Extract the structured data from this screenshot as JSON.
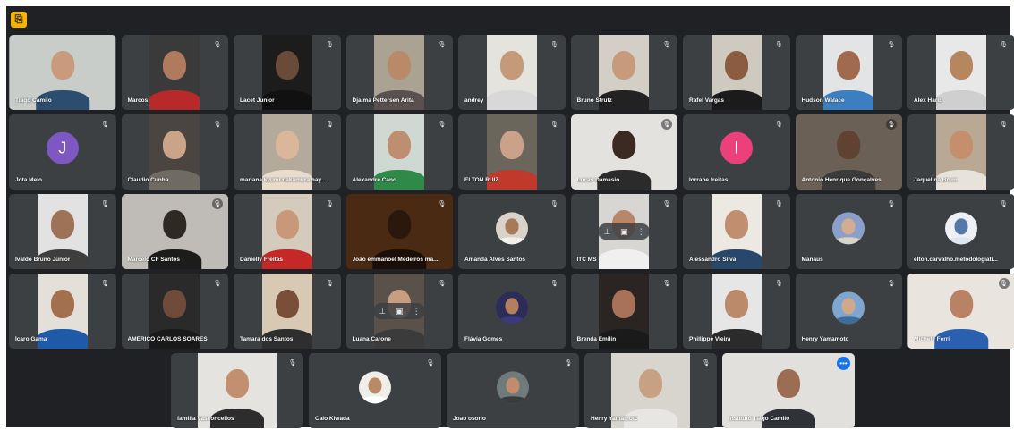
{
  "toolbar": {
    "icon": "meeting-details-icon",
    "icon_glyph": "⎘"
  },
  "accent_color": "#8ab4f8",
  "tile_background": "#3c4043",
  "participants": [
    {
      "name": "Tiago Camilo",
      "muted": false,
      "view": "full",
      "bg": "#c8cdc9",
      "skin": "#c99a7c",
      "shirt": "#2d4d6e"
    },
    {
      "name": "Marcos",
      "muted": true,
      "view": "narrow",
      "bg": "#3a3a3a",
      "skin": "#b07a5e",
      "shirt": "#b82a2a"
    },
    {
      "name": "Lacet Junior",
      "muted": true,
      "view": "narrow",
      "bg": "#1c1c1c",
      "skin": "#6a4a38",
      "shirt": "#111111"
    },
    {
      "name": "Djalma Pettersen Arita",
      "muted": true,
      "view": "narrow",
      "bg": "#aaa293",
      "skin": "#b98a6a",
      "shirt": "#5a5050"
    },
    {
      "name": "andrey",
      "muted": true,
      "view": "narrow",
      "bg": "#e5e3dd",
      "skin": "#c49a7a",
      "shirt": "#d8d8d8"
    },
    {
      "name": "Bruno Strutz",
      "muted": true,
      "view": "narrow",
      "bg": "#d3cfc6",
      "skin": "#c79a7c",
      "shirt": "#222222"
    },
    {
      "name": "Rafel Vargas",
      "muted": true,
      "view": "narrow",
      "bg": "#cfcac0",
      "skin": "#8c5c42",
      "shirt": "#1b1b1b"
    },
    {
      "name": "Hudson Walace",
      "muted": true,
      "view": "narrow",
      "bg": "#e3e4e6",
      "skin": "#a06a4e",
      "shirt": "#3b7fc0"
    },
    {
      "name": "Alex Harib",
      "muted": true,
      "view": "narrow",
      "bg": "#e8e8e8",
      "skin": "#b6865f",
      "shirt": "#cfcfcf"
    },
    {
      "name": "Jota Melo",
      "muted": true,
      "view": "avatar",
      "initial": "J",
      "avatar_color": "#7e57c2"
    },
    {
      "name": "Claudio Cunha",
      "muted": true,
      "view": "narrow",
      "bg": "#4a4540",
      "skin": "#c9a489",
      "shirt": "#6f6a62"
    },
    {
      "name": "mariana kyumi nakamura hay...",
      "muted": true,
      "view": "narrow",
      "bg": "#b4aa9c",
      "skin": "#dab69a",
      "shirt": "#e8dccd"
    },
    {
      "name": "Alexandre Cano",
      "muted": true,
      "view": "narrow",
      "bg": "#cfd8d3",
      "skin": "#bd8f70",
      "shirt": "#2f8a4a"
    },
    {
      "name": "ELTON RUIZ",
      "muted": true,
      "view": "narrow",
      "bg": "#6b655c",
      "skin": "#caa28a",
      "shirt": "#c0392b"
    },
    {
      "name": "Lucas Damasio",
      "muted": true,
      "view": "full",
      "bg": "#e4e2df",
      "skin": "#3b2a22",
      "shirt": "#2b2b2b",
      "mute_style": "circle"
    },
    {
      "name": "lorrane freitas",
      "muted": true,
      "view": "avatar",
      "initial": "l",
      "avatar_color": "#ec407a"
    },
    {
      "name": "Antonio Henrique Gonçalves",
      "muted": true,
      "view": "full",
      "bg": "#6a6055",
      "skin": "#5f4232",
      "shirt": "#3a3a3a",
      "mute_style": "circle"
    },
    {
      "name": "Jaquelina Brum",
      "muted": true,
      "view": "narrow",
      "bg": "#b8a894",
      "skin": "#c58f6d",
      "shirt": "#e7e2da"
    },
    {
      "name": "Ivaldo Bruno Junior",
      "muted": true,
      "view": "narrow",
      "bg": "#e2e2e2",
      "skin": "#9e7256",
      "shirt": "#3e3e3e"
    },
    {
      "name": "Marcelo CF Santos",
      "muted": true,
      "view": "full",
      "bg": "#bfbcb7",
      "skin": "#2f2924",
      "shirt": "#1c1c1c",
      "mute_style": "circle"
    },
    {
      "name": "Danielly Freitas",
      "muted": true,
      "view": "narrow",
      "bg": "#d5cbbd",
      "skin": "#c99779",
      "shirt": "#c62828"
    },
    {
      "name": "João emmanoel Medeiros ma...",
      "muted": true,
      "view": "full",
      "bg": "#4a2a12",
      "skin": "#2a180d",
      "shirt": "#1a0e06"
    },
    {
      "name": "Amanda Alves Santos",
      "muted": true,
      "view": "round",
      "bg": "#d9d2c8",
      "skin": "#a8785b",
      "shirt": "#f2eee9"
    },
    {
      "name": "ITC MS",
      "muted": true,
      "view": "narrow",
      "bg": "#d8d6d3",
      "skin": "#b98669",
      "shirt": "#f0f0f0",
      "hover": true
    },
    {
      "name": "Alessandro Silva",
      "muted": true,
      "view": "narrow",
      "bg": "#ece9e2",
      "skin": "#c18f70",
      "shirt": "#27476b"
    },
    {
      "name": "Manaus",
      "muted": true,
      "view": "round",
      "bg": "#8aa0c8",
      "skin": "#d3ad92",
      "shirt": "#d8d4c8"
    },
    {
      "name": "elton.carvalho.metodologiati...",
      "muted": true,
      "view": "round",
      "bg": "#eef0f4",
      "skin": "#5577aa",
      "shirt": "#dfe6f2"
    },
    {
      "name": "Ícaro Gama",
      "muted": true,
      "view": "narrow",
      "bg": "#e3e0da",
      "skin": "#a3704f",
      "shirt": "#1e5aa8"
    },
    {
      "name": "AMÉRICO CARLOS SOARES",
      "muted": true,
      "view": "narrow",
      "bg": "#2a2a2a",
      "skin": "#6e4c39",
      "shirt": "#1a1a1a"
    },
    {
      "name": "Tamara dos Santos",
      "muted": true,
      "view": "narrow",
      "bg": "#d8c9b4",
      "skin": "#7a4f3a",
      "shirt": "#2e2e2e"
    },
    {
      "name": "Luana Carone",
      "muted": true,
      "view": "narrow",
      "bg": "#5a524a",
      "skin": "#c99d80",
      "shirt": "#3b3b3b",
      "hover": true
    },
    {
      "name": "Flávia Gomes",
      "muted": true,
      "view": "round",
      "bg": "#2b2c5a",
      "skin": "#b57e5e",
      "shirt": "#3d3a7a"
    },
    {
      "name": "Brenda Emilin",
      "muted": true,
      "view": "narrow",
      "bg": "#2a2522",
      "skin": "#a87258",
      "shirt": "#1a1a1a"
    },
    {
      "name": "Phillippe Vieira",
      "muted": true,
      "view": "narrow",
      "bg": "#e6e6e6",
      "skin": "#bb8a6a",
      "shirt": "#2b2b2b"
    },
    {
      "name": "Henry Yamamoto",
      "muted": true,
      "view": "round",
      "bg": "#7ea6cf",
      "skin": "#d0a88a",
      "shirt": "#3d6d98"
    },
    {
      "name": "Michele Ferri",
      "muted": true,
      "view": "full",
      "bg": "#e9e4de",
      "skin": "#b98264",
      "shirt": "#2b5fb0",
      "mute_style": "circle"
    }
  ],
  "last_row": [
    {
      "name": "familia Vasconcellos",
      "muted": true,
      "view": "narrow",
      "bg": "#e5e3e0",
      "skin": "#c29070",
      "shirt": "#2d2d2d"
    },
    {
      "name": "Caio Kiwada",
      "muted": true,
      "view": "round",
      "bg": "#f0eee8",
      "skin": "#b98a66",
      "shirt": "#ffffff"
    },
    {
      "name": "Joao osorio",
      "muted": true,
      "view": "round",
      "bg": "#6f7b7a",
      "skin": "#c18c6b",
      "shirt": "#3b3b3b"
    },
    {
      "name": "Henry Yamamoto",
      "muted": true,
      "view": "narrow",
      "bg": "#d8d5cf",
      "skin": "#c8a082",
      "shirt": "#e8e6e2"
    },
    {
      "name": "Instituto Tiago Camilo",
      "muted": false,
      "view": "full",
      "bg": "#e2e0dd",
      "skin": "#9c6d53",
      "shirt": "#2f3337",
      "active": true,
      "more": true
    }
  ],
  "icons": {
    "mute": "microphone-off-icon",
    "pin": "pin-icon",
    "more": "more-options-icon"
  }
}
